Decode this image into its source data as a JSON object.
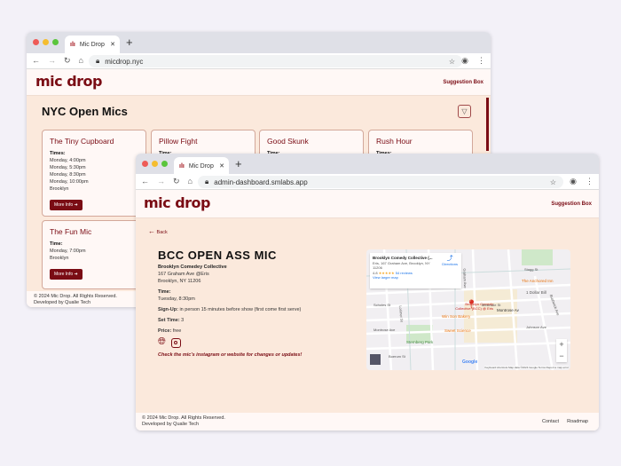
{
  "back_window": {
    "tab_title": "Mic Drop",
    "url": "micdrop.nyc",
    "logo": "mic drop",
    "suggestion": "Suggestion Box",
    "page_title": "NYC Open Mics",
    "cards": [
      {
        "name": "The Tiny Cupboard",
        "label": "Times:",
        "lines": [
          "Monday, 4:00pm",
          "Monday, 5:30pm",
          "Monday, 8:30pm",
          "Monday, 10:00pm",
          "Brooklyn"
        ],
        "button": "More Info ➜"
      },
      {
        "name": "Pillow Fight",
        "label": "Time:",
        "lines": [],
        "button": ""
      },
      {
        "name": "Good Skunk",
        "label": "Time:",
        "lines": [],
        "button": ""
      },
      {
        "name": "Rush Hour",
        "label": "Times:",
        "lines": [],
        "button": ""
      },
      {
        "name": "The Fun Mic",
        "label": "Time:",
        "lines": [
          "Monday, 7:00pm",
          "Brooklyn"
        ],
        "button": "More Info ➜"
      }
    ],
    "footer": [
      "© 2024 Mic Drop. All Rights Reserved.",
      "Developed by Qualie Tech"
    ]
  },
  "front_window": {
    "tab_title": "Mic Drop",
    "url": "admin-dashboard.smlabs.app",
    "logo": "mic drop",
    "suggestion": "Suggestion Box",
    "back": "Back",
    "title": "BCC OPEN ASS MIC",
    "venue": "Brooklyn Comedey Collective",
    "address1": "167 Graham Ave @Eris",
    "address2": "Brooklyn, NY 11206",
    "time_label": "Time:",
    "time": "Tuesday, 8:30pm",
    "signup_label": "Sign-Up:",
    "signup": " in person 15 minutes before show (first come first serve)",
    "settime_label": "Set Time:",
    "settime": " 3",
    "price_label": "Price:",
    "price": " free",
    "note": "Check the mic's instagram or website for changes or updates!",
    "map": {
      "place": "Brooklyn Comedy Collective (...",
      "addr": "Eris, 167 Graham Ave, Brooklyn, NY 11206",
      "rating": "4.8",
      "stars": "★★★★★",
      "reviews": "54 reviews",
      "larger": "View larger map",
      "directions": "Directions",
      "pin": "Brooklyn Comedy Collective (BCC) @ Eris",
      "labels": [
        "Win Son Bakery",
        "Sweet Science",
        "The Anchored Inn",
        "1 Dollar Bill",
        "Montrose Av",
        "Sternberg Park",
        "Scholes St",
        "Meserole St",
        "Montrose Ave",
        "Johnson Ave",
        "Boerum St",
        "Stagg St",
        "Bushwick Ave",
        "Graham Ave",
        "Lorimer St"
      ],
      "footer": "Keyboard shortcuts   Map data ©2024 Google   Terms   Report a map error",
      "google": "Google"
    },
    "footer": [
      "© 2024 Mic Drop. All Rights Reserved.",
      "Developed by Qualie Tech"
    ],
    "footer_links": [
      "Contact",
      "Roadmap"
    ]
  }
}
